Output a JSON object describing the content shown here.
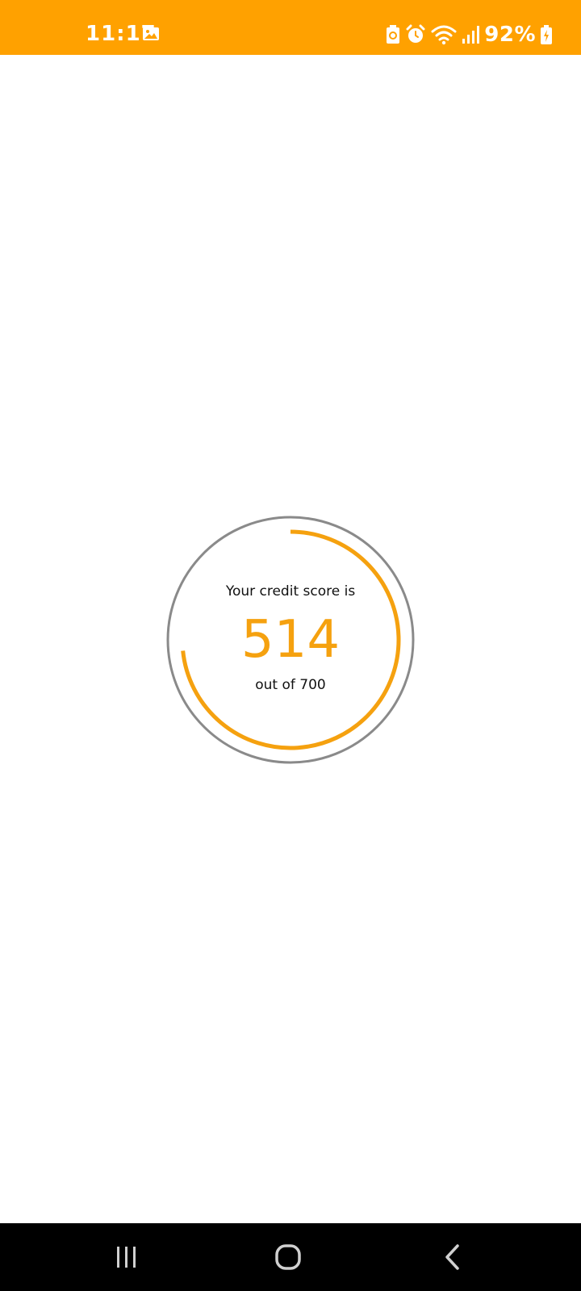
{
  "status_bar": {
    "time": "11:17",
    "battery": "92%",
    "background_color": "#FFA100",
    "icons": [
      "gallery-icon",
      "battery-saver-icon",
      "alarm-icon",
      "wifi-icon",
      "signal-icon",
      "battery-charging-icon"
    ]
  },
  "credit_score": {
    "label": "Your credit score is",
    "score": "514",
    "max_text": "out of 700",
    "progress_fraction": 0.734,
    "arc_color": "#F5A10F",
    "ring_color": "#8A8A8A"
  },
  "nav_bar": {
    "buttons": [
      "recents-icon",
      "home-icon",
      "back-icon"
    ]
  }
}
